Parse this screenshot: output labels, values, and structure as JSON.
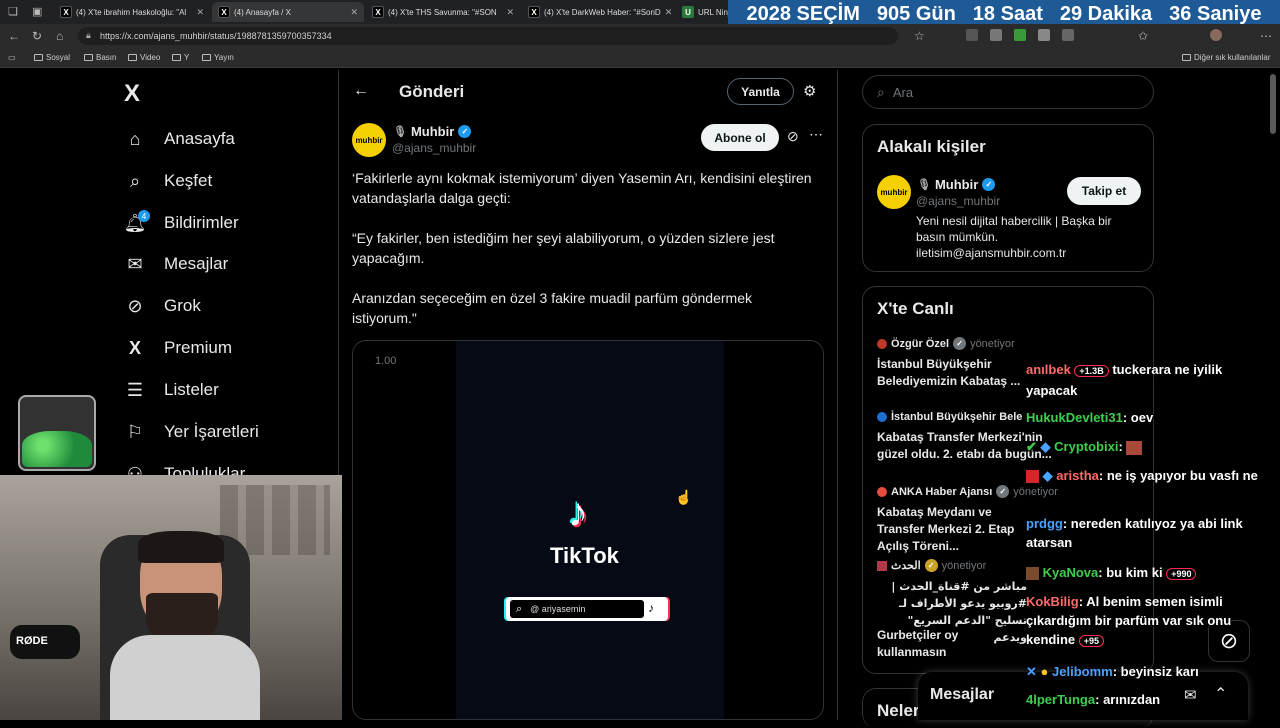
{
  "browser": {
    "tabs": [
      {
        "label": "(4) X'te ibrahim Haskoloğlu: \"Al"
      },
      {
        "label": "(4) Anasayfa / X"
      },
      {
        "label": "(4) X'te THS Savunma: \"#SON"
      },
      {
        "label": "(4) X'te DarkWeb Haber: \"#SonD"
      },
      {
        "label": "URL Ninja"
      }
    ],
    "url": "https://x.com/ajans_muhbir/status/1988781359700357334",
    "bookmarks": [
      "Sosyal",
      "Basın",
      "Video",
      "Y",
      "Yayın"
    ],
    "other_bookmarks": "Diğer sık kullanılanlar"
  },
  "countdown": {
    "year_label": "2028 SEÇİM",
    "days": "905 Gün",
    "hours": "18 Saat",
    "minutes": "29 Dakika",
    "seconds": "36 Saniye"
  },
  "nav": {
    "logo": "X",
    "notifications_badge": "4",
    "items": [
      {
        "label": "Anasayfa",
        "icon": "home-icon"
      },
      {
        "label": "Keşfet",
        "icon": "search-icon"
      },
      {
        "label": "Bildirimler",
        "icon": "bell-icon"
      },
      {
        "label": "Mesajlar",
        "icon": "mail-icon"
      },
      {
        "label": "Grok",
        "icon": "grok-icon"
      },
      {
        "label": "Premium",
        "icon": "x-icon"
      },
      {
        "label": "Listeler",
        "icon": "list-icon"
      },
      {
        "label": "Yer İşaretleri",
        "icon": "bookmark-icon"
      },
      {
        "label": "Topluluklar",
        "icon": "people-icon"
      }
    ]
  },
  "post": {
    "header_title": "Gönderi",
    "reply_label": "Yanıtla",
    "author_name": "Muhbir",
    "author_handle": "@ajans_muhbir",
    "avatar_text": "muhbir",
    "subscribe_label": "Abone ol",
    "paragraph1": "‘Fakirlerle aynı kokmak istemiyorum’ diyen Yasemin Arı, kendisini eleştiren vatandaşlarla dalga geçti:",
    "paragraph2": "“Ey fakirler, ben istediğim her şeyi alabiliyorum, o yüzden sizlere jest yapacağım.",
    "paragraph3": "Aranızdan seçeceğim en özel 3 fakire muadil parfüm göndermek istiyorum.\"",
    "video_timestamp": "1.00",
    "tiktok_label": "TikTok",
    "tiktok_handle": "@ ariyasemin"
  },
  "sidebar": {
    "search_placeholder": "Ara",
    "related_title": "Alakalı kişiler",
    "related_name": "Muhbir",
    "related_handle": "@ajans_muhbir",
    "follow_label": "Takip et",
    "related_bio": "Yeni nesil dijital habercilik | Başka bir basın mümkün. iletisim@ajansmuhbir.com.tr",
    "live_title": "X'te Canlı",
    "live_items": [
      {
        "host": "Özgür Özel",
        "role": "yönetiyor",
        "title": "İstanbul Büyükşehir Belediyemizin Kabataş ..."
      },
      {
        "host": "İstanbul Büyükşehir Bele",
        "role": "",
        "title": "Kabataş Transfer Merkezi'nin güzel oldu. 2. etabı da bugün..."
      },
      {
        "host": "ANKA Haber Ajansı",
        "role": "yönetiyor",
        "title": "Kabataş Meydanı ve Transfer Merkezi 2. Etap Açılış Töreni..."
      },
      {
        "host": "الحدث",
        "role": "yönetiyor",
        "title": "مباشر من #قناة_الحدث | #روبيو يدعو الأطراف لـ تسليح \"الدعم السريع\" ويدعم"
      },
      {
        "host": "",
        "role": "",
        "title": "Gurbetçiler oy kullanmasın"
      }
    ],
    "next_title": "Neler"
  },
  "chat": [
    {
      "user": "anılbek",
      "text": "tuckerara ne iyilik yapacak",
      "color": "#ff6a6a"
    },
    {
      "user": "HukukDevleti31",
      "text": "oev",
      "color": "#3ecf4e"
    },
    {
      "user": "Cryptobixi",
      "text": "",
      "color": "#3ecf4e"
    },
    {
      "user": "aristha",
      "text": "ne iş yapıyor bu vasfı ne",
      "color": "#ff6a6a"
    },
    {
      "user": "prdgg",
      "text": "nereden katılıyoz ya abi link atarsan",
      "color": "#4aa3ff"
    },
    {
      "user": "KyaNova",
      "text": "bu kim ki",
      "color": "#3ecf4e"
    },
    {
      "user": "KokBilig",
      "text": "Al benim semen isimli çıkardığım bir parfüm var sık onu kendine",
      "color": "#ff6a6a"
    },
    {
      "user": "Jelibomm",
      "text": "beyinsiz karı",
      "color": "#4aa3ff"
    },
    {
      "user": "4lperTunga",
      "text": "arınızdan",
      "color": "#3ecf4e"
    }
  ],
  "chat_badges": {
    "badge1": "+1.3B",
    "badge2": "+990",
    "badge3": "+95"
  },
  "messages_drawer": {
    "label": "Mesajlar"
  }
}
